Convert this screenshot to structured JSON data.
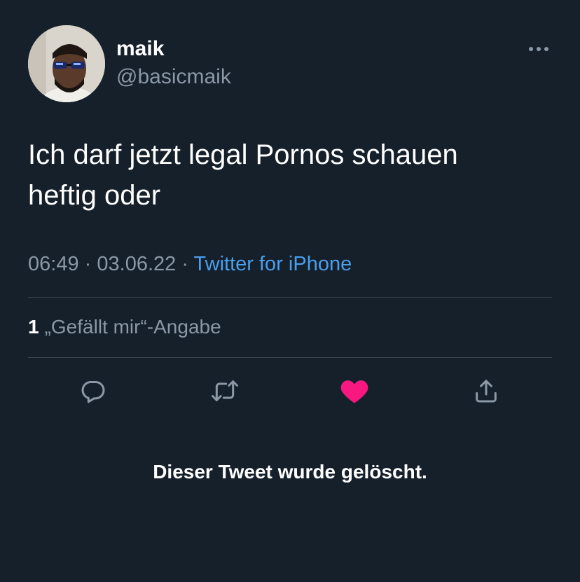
{
  "author": {
    "display_name": "maik",
    "handle": "@basicmaik",
    "avatar_icon": "user-avatar-photo"
  },
  "tweet": {
    "text": "Ich darf jetzt legal Pornos schauen\nheftig oder",
    "time": "06:49",
    "date": "03.06.22",
    "separator": "·",
    "source": "Twitter for iPhone"
  },
  "stats": {
    "like_count": "1",
    "like_label": "„Gefällt mir“-Angabe"
  },
  "actions": {
    "reply_icon": "reply-icon",
    "retweet_icon": "retweet-icon",
    "like_icon": "heart-icon",
    "share_icon": "share-icon",
    "more_icon": "more-icon"
  },
  "notice": {
    "deleted_text": "Dieser Tweet wurde gelöscht."
  },
  "colors": {
    "background": "#15202b",
    "secondary_text": "#8b98a5",
    "link": "#4a9eeb",
    "like_active": "#f91880",
    "divider": "#38444d"
  }
}
